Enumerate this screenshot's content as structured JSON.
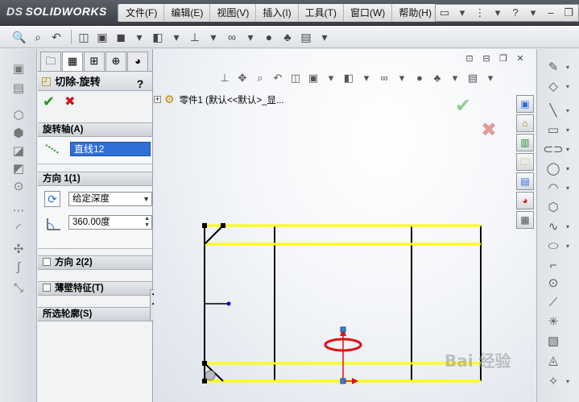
{
  "app": {
    "logo_ds": "DS",
    "logo_text": "SOLIDWORKS"
  },
  "menu": {
    "items": [
      {
        "label": "文件(F)"
      },
      {
        "label": "编辑(E)"
      },
      {
        "label": "视图(V)"
      },
      {
        "label": "插入(I)"
      },
      {
        "label": "工具(T)"
      },
      {
        "label": "窗口(W)"
      },
      {
        "label": "帮助(H)"
      }
    ]
  },
  "property_manager": {
    "title": "切除-旋转",
    "help": "?",
    "axis_group": {
      "header": "旋转轴(A)",
      "value": "直线12"
    },
    "direction1": {
      "header": "方向 1(1)",
      "end_condition": "给定深度",
      "angle": "360.00度"
    },
    "direction2": {
      "header": "方向 2(2)"
    },
    "thin_feature": {
      "header": "薄壁特征(T)"
    },
    "selected_contours": {
      "header": "所选轮廓(S)"
    }
  },
  "tree": {
    "expander": "⊞",
    "part_label": "零件1  (默认<<默认>_显..."
  },
  "colors": {
    "sketch_yellow": "#ffff00",
    "sketch_black": "#000000",
    "accent_blue": "#2f6fd6",
    "ok_green": "#1a9a1a",
    "cancel_red": "#d01818",
    "ellipse_red": "#e01010"
  },
  "watermark": "Bai 经验"
}
